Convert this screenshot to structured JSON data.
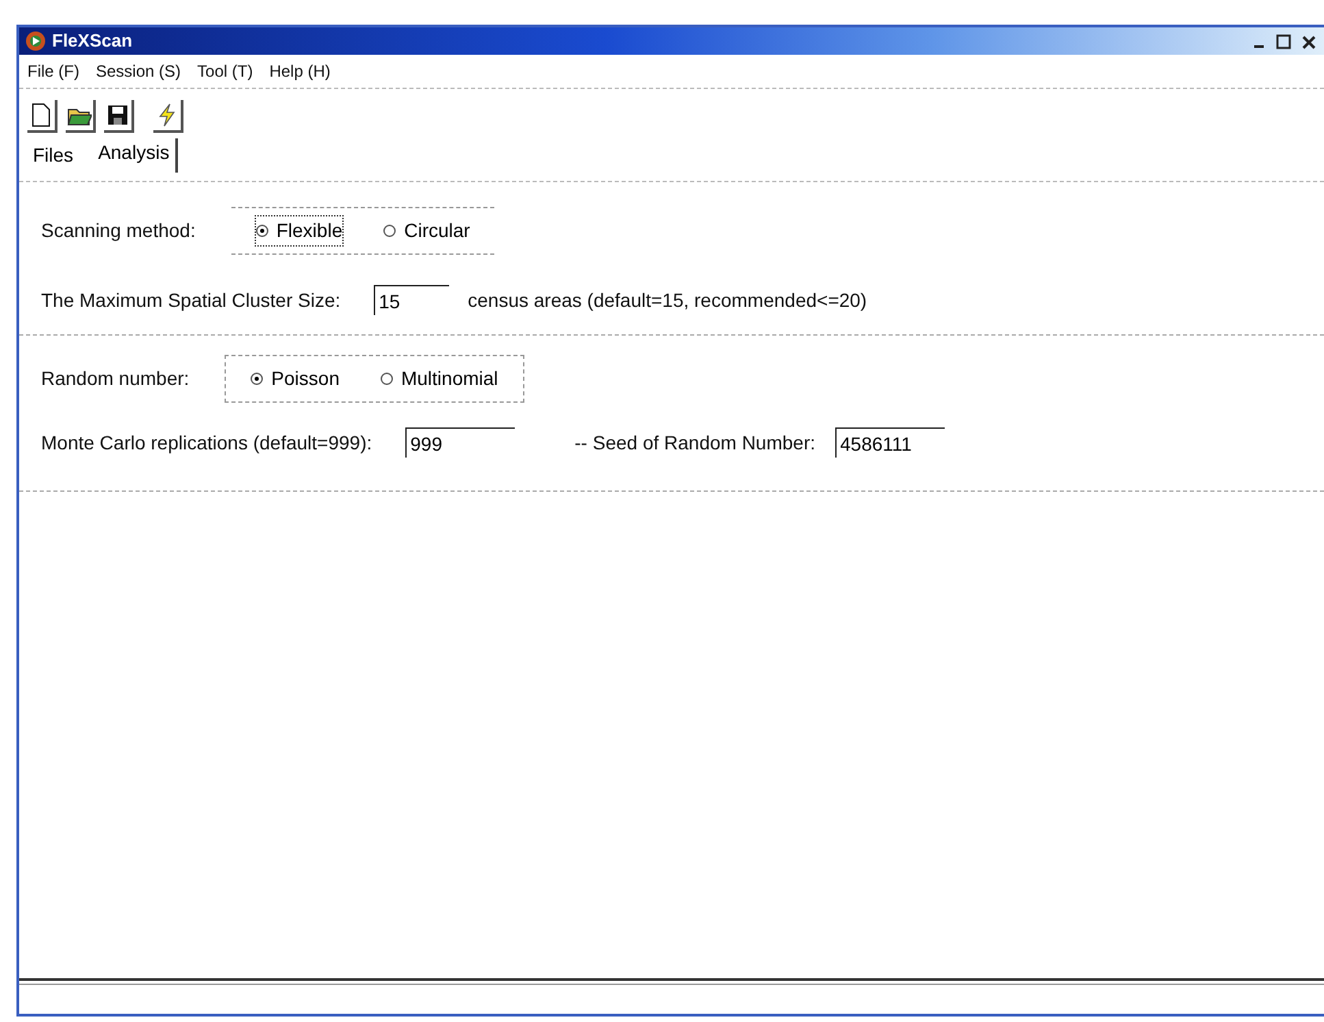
{
  "window": {
    "title": "FleXScan"
  },
  "menu": [
    "File (F)",
    "Session (S)",
    "Tool (T)",
    "Help (H)"
  ],
  "tabs": [
    {
      "label": "Files",
      "selected": false
    },
    {
      "label": "Analysis",
      "selected": true
    }
  ],
  "scanning": {
    "label": "Scanning method:",
    "options": [
      {
        "label": "Flexible",
        "selected": true
      },
      {
        "label": "Circular",
        "selected": false
      }
    ]
  },
  "cluster_size": {
    "label": "The Maximum Spatial Cluster Size:",
    "value": "15",
    "note": "census areas (default=15, recommended<=20)"
  },
  "random": {
    "label": "Random number:",
    "options": [
      {
        "label": "Poisson",
        "selected": true
      },
      {
        "label": "Multinomial",
        "selected": false
      }
    ]
  },
  "replications": {
    "label": "Monte Carlo replications (default=999):",
    "value": "999"
  },
  "seed": {
    "label": "-- Seed of Random Number:",
    "value": "4586111"
  }
}
